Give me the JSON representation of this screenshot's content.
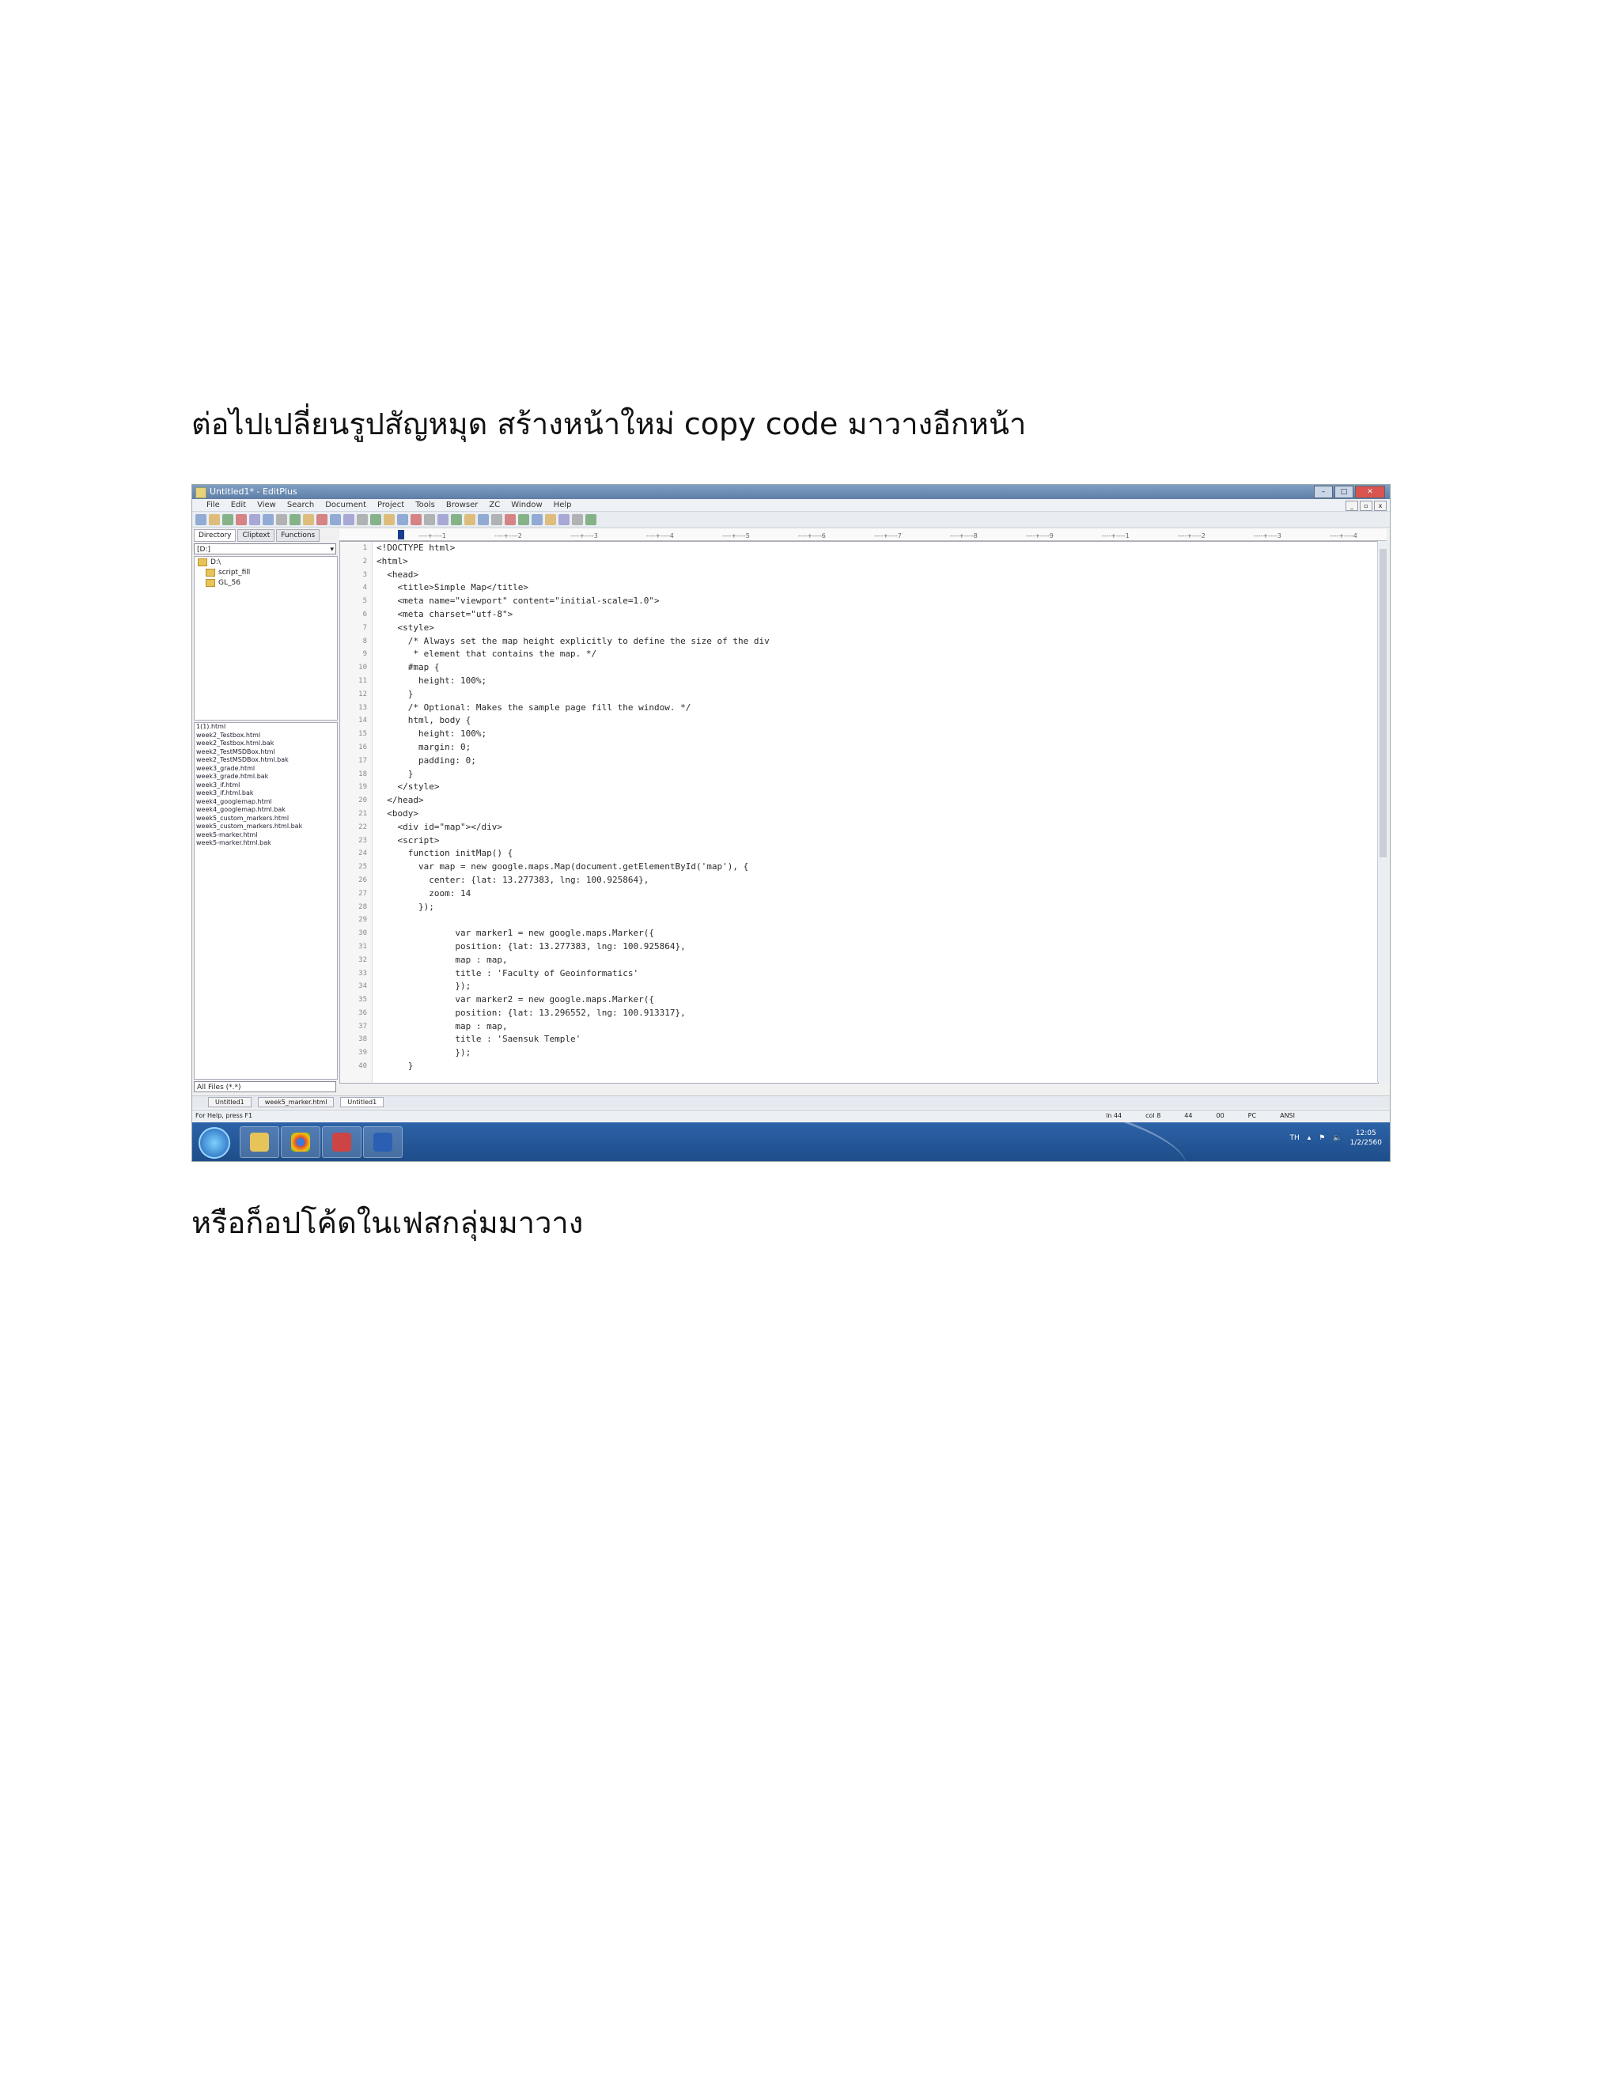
{
  "paragraphs": {
    "p1": "ต่อไปเปลี่ยนรูปสัญหมุด สร้างหน้าใหม่ copy code มาวางอีกหน้า",
    "p2": "หรือก็อปโค้ดในเฟสกลุ่มมาวาง"
  },
  "window": {
    "title": "Untitled1* - EditPlus"
  },
  "menu": [
    "File",
    "Edit",
    "View",
    "Search",
    "Document",
    "Project",
    "Tools",
    "Browser",
    "ZC",
    "Window",
    "Help"
  ],
  "sidebar": {
    "tabs": [
      "Directory",
      "Cliptext",
      "Functions"
    ],
    "drive": "[D:]",
    "tree": [
      "D:\\",
      "script_fill",
      "GL_56"
    ],
    "files": [
      "1(1).html",
      "week2_Testbox.html",
      "week2_Testbox.html.bak",
      "week2_TestMSDBox.html",
      "week2_TestMSDBox.html.bak",
      "week3_grade.html",
      "week3_grade.html.bak",
      "week3_if.html",
      "week3_if.html.bak",
      "week4_googlemap.html",
      "week4_googlemap.html.bak",
      "week5_custom_markers.html",
      "week5_custom_markers.html.bak",
      "week5-marker.html",
      "week5-marker.html.bak"
    ],
    "filter": "All Files (*.*)"
  },
  "editor": {
    "line_numbers": [
      "1",
      "2",
      "3",
      "4",
      "5",
      "6",
      "7",
      "8",
      "9",
      "10",
      "11",
      "12",
      "13",
      "14",
      "15",
      "16",
      "17",
      "18",
      "19",
      "20",
      "21",
      "22",
      "23",
      "24",
      "25",
      "26",
      "27",
      "28",
      "29",
      "30",
      "31",
      "32",
      "33",
      "34",
      "35",
      "36",
      "37",
      "38",
      "39",
      "40"
    ],
    "lines": [
      "<!DOCTYPE html>",
      "<html>",
      "  <head>",
      "    <title>Simple Map</title>",
      "    <meta name=\"viewport\" content=\"initial-scale=1.0\">",
      "    <meta charset=\"utf-8\">",
      "    <style>",
      "      /* Always set the map height explicitly to define the size of the div",
      "       * element that contains the map. */",
      "      #map {",
      "        height: 100%;",
      "      }",
      "      /* Optional: Makes the sample page fill the window. */",
      "      html, body {",
      "        height: 100%;",
      "        margin: 0;",
      "        padding: 0;",
      "      }",
      "    </style>",
      "  </head>",
      "  <body>",
      "    <div id=\"map\"></div>",
      "    <script>",
      "      function initMap() {",
      "        var map = new google.maps.Map(document.getElementById('map'), {",
      "          center: {lat: 13.277383, lng: 100.925864},",
      "          zoom: 14",
      "        });",
      "",
      "               var marker1 = new google.maps.Marker({",
      "               position: {lat: 13.277383, lng: 100.925864},",
      "               map : map,",
      "               title : 'Faculty of Geoinformatics'",
      "               });",
      "               var marker2 = new google.maps.Marker({",
      "               position: {lat: 13.296552, lng: 100.913317},",
      "               map : map,",
      "               title : 'Saensuk Temple'",
      "               });",
      "      }"
    ]
  },
  "doc_tabs": [
    "Untitled1",
    "week5_marker.html",
    "Untitled1"
  ],
  "status": {
    "help": "For Help, press F1",
    "cells": [
      "ln 44",
      "col 8",
      "44",
      "00",
      "PC",
      "ANSI"
    ]
  },
  "taskbar": {
    "time": "12:05",
    "date": "1/2/2560",
    "lang": "TH"
  },
  "colors": {
    "titlebar": "#6a8ab3",
    "taskbar": "#2459a0",
    "accent": "#1b3d8f"
  }
}
